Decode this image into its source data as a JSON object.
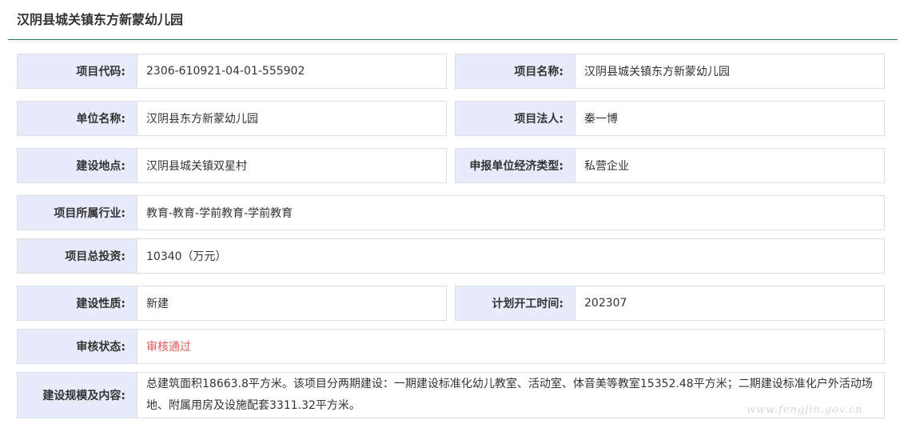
{
  "page": {
    "title": "汉阴县城关镇东方新蒙幼儿园"
  },
  "fields": {
    "project_code": {
      "label": "项目代码:",
      "value": "2306-610921-04-01-555902"
    },
    "project_name": {
      "label": "项目名称:",
      "value": "汉阴县城关镇东方新蒙幼儿园"
    },
    "unit_name": {
      "label": "单位名称:",
      "value": "汉阴县东方新蒙幼儿园"
    },
    "legal_person": {
      "label": "项目法人:",
      "value": "秦一博"
    },
    "location": {
      "label": "建设地点:",
      "value": "汉阴县城关镇双星村"
    },
    "economic_type": {
      "label": "申报单位经济类型:",
      "value": "私营企业"
    },
    "industry": {
      "label": "项目所属行业:",
      "value": "教育-教育-学前教育-学前教育"
    },
    "total_investment": {
      "label": "项目总投资:",
      "value": "10340（万元）"
    },
    "nature": {
      "label": "建设性质:",
      "value": "新建"
    },
    "start_time": {
      "label": "计划开工时间:",
      "value": "202307"
    },
    "audit_status": {
      "label": "审核状态:",
      "value": "审核通过"
    },
    "scale_content": {
      "label": "建设规模及内容:",
      "value": "总建筑面积18663.8平方米。该项目分两期建设：一期建设标准化幼儿教室、活动室、体音美等教室15352.48平方米；二期建设标准化户外活动场地、附属用房及设施配套3311.32平方米。"
    }
  },
  "watermark": "www.fengjin.gov.cn",
  "colors": {
    "label_bg": "#e8ebf9",
    "border": "#dcdfe6",
    "rule": "#2b6b70",
    "status": "#e05a5a"
  }
}
